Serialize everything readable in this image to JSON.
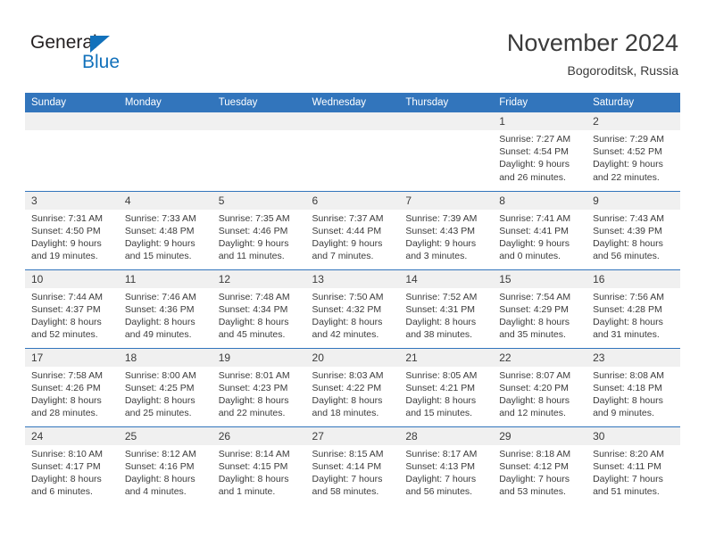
{
  "brand": {
    "name_part1": "General",
    "name_part2": "Blue",
    "triangle_color": "#1271bb"
  },
  "header": {
    "title": "November 2024",
    "location": "Bogoroditsk, Russia",
    "header_bg": "#3275bc",
    "daynum_bg": "#f0f0f0",
    "text_color": "#3b3b3b"
  },
  "weekday_headers": [
    "Sunday",
    "Monday",
    "Tuesday",
    "Wednesday",
    "Thursday",
    "Friday",
    "Saturday"
  ],
  "labels": {
    "sunrise_prefix": "Sunrise: ",
    "sunset_prefix": "Sunset: ",
    "daylight_prefix": "Daylight: "
  },
  "weeks": [
    [
      {
        "day": "",
        "empty": true
      },
      {
        "day": "",
        "empty": true
      },
      {
        "day": "",
        "empty": true
      },
      {
        "day": "",
        "empty": true
      },
      {
        "day": "",
        "empty": true
      },
      {
        "day": "1",
        "sunrise": "Sunrise: 7:27 AM",
        "sunset": "Sunset: 4:54 PM",
        "daylight": "Daylight: 9 hours and 26 minutes."
      },
      {
        "day": "2",
        "sunrise": "Sunrise: 7:29 AM",
        "sunset": "Sunset: 4:52 PM",
        "daylight": "Daylight: 9 hours and 22 minutes."
      }
    ],
    [
      {
        "day": "3",
        "sunrise": "Sunrise: 7:31 AM",
        "sunset": "Sunset: 4:50 PM",
        "daylight": "Daylight: 9 hours and 19 minutes."
      },
      {
        "day": "4",
        "sunrise": "Sunrise: 7:33 AM",
        "sunset": "Sunset: 4:48 PM",
        "daylight": "Daylight: 9 hours and 15 minutes."
      },
      {
        "day": "5",
        "sunrise": "Sunrise: 7:35 AM",
        "sunset": "Sunset: 4:46 PM",
        "daylight": "Daylight: 9 hours and 11 minutes."
      },
      {
        "day": "6",
        "sunrise": "Sunrise: 7:37 AM",
        "sunset": "Sunset: 4:44 PM",
        "daylight": "Daylight: 9 hours and 7 minutes."
      },
      {
        "day": "7",
        "sunrise": "Sunrise: 7:39 AM",
        "sunset": "Sunset: 4:43 PM",
        "daylight": "Daylight: 9 hours and 3 minutes."
      },
      {
        "day": "8",
        "sunrise": "Sunrise: 7:41 AM",
        "sunset": "Sunset: 4:41 PM",
        "daylight": "Daylight: 9 hours and 0 minutes."
      },
      {
        "day": "9",
        "sunrise": "Sunrise: 7:43 AM",
        "sunset": "Sunset: 4:39 PM",
        "daylight": "Daylight: 8 hours and 56 minutes."
      }
    ],
    [
      {
        "day": "10",
        "sunrise": "Sunrise: 7:44 AM",
        "sunset": "Sunset: 4:37 PM",
        "daylight": "Daylight: 8 hours and 52 minutes."
      },
      {
        "day": "11",
        "sunrise": "Sunrise: 7:46 AM",
        "sunset": "Sunset: 4:36 PM",
        "daylight": "Daylight: 8 hours and 49 minutes."
      },
      {
        "day": "12",
        "sunrise": "Sunrise: 7:48 AM",
        "sunset": "Sunset: 4:34 PM",
        "daylight": "Daylight: 8 hours and 45 minutes."
      },
      {
        "day": "13",
        "sunrise": "Sunrise: 7:50 AM",
        "sunset": "Sunset: 4:32 PM",
        "daylight": "Daylight: 8 hours and 42 minutes."
      },
      {
        "day": "14",
        "sunrise": "Sunrise: 7:52 AM",
        "sunset": "Sunset: 4:31 PM",
        "daylight": "Daylight: 8 hours and 38 minutes."
      },
      {
        "day": "15",
        "sunrise": "Sunrise: 7:54 AM",
        "sunset": "Sunset: 4:29 PM",
        "daylight": "Daylight: 8 hours and 35 minutes."
      },
      {
        "day": "16",
        "sunrise": "Sunrise: 7:56 AM",
        "sunset": "Sunset: 4:28 PM",
        "daylight": "Daylight: 8 hours and 31 minutes."
      }
    ],
    [
      {
        "day": "17",
        "sunrise": "Sunrise: 7:58 AM",
        "sunset": "Sunset: 4:26 PM",
        "daylight": "Daylight: 8 hours and 28 minutes."
      },
      {
        "day": "18",
        "sunrise": "Sunrise: 8:00 AM",
        "sunset": "Sunset: 4:25 PM",
        "daylight": "Daylight: 8 hours and 25 minutes."
      },
      {
        "day": "19",
        "sunrise": "Sunrise: 8:01 AM",
        "sunset": "Sunset: 4:23 PM",
        "daylight": "Daylight: 8 hours and 22 minutes."
      },
      {
        "day": "20",
        "sunrise": "Sunrise: 8:03 AM",
        "sunset": "Sunset: 4:22 PM",
        "daylight": "Daylight: 8 hours and 18 minutes."
      },
      {
        "day": "21",
        "sunrise": "Sunrise: 8:05 AM",
        "sunset": "Sunset: 4:21 PM",
        "daylight": "Daylight: 8 hours and 15 minutes."
      },
      {
        "day": "22",
        "sunrise": "Sunrise: 8:07 AM",
        "sunset": "Sunset: 4:20 PM",
        "daylight": "Daylight: 8 hours and 12 minutes."
      },
      {
        "day": "23",
        "sunrise": "Sunrise: 8:08 AM",
        "sunset": "Sunset: 4:18 PM",
        "daylight": "Daylight: 8 hours and 9 minutes."
      }
    ],
    [
      {
        "day": "24",
        "sunrise": "Sunrise: 8:10 AM",
        "sunset": "Sunset: 4:17 PM",
        "daylight": "Daylight: 8 hours and 6 minutes."
      },
      {
        "day": "25",
        "sunrise": "Sunrise: 8:12 AM",
        "sunset": "Sunset: 4:16 PM",
        "daylight": "Daylight: 8 hours and 4 minutes."
      },
      {
        "day": "26",
        "sunrise": "Sunrise: 8:14 AM",
        "sunset": "Sunset: 4:15 PM",
        "daylight": "Daylight: 8 hours and 1 minute."
      },
      {
        "day": "27",
        "sunrise": "Sunrise: 8:15 AM",
        "sunset": "Sunset: 4:14 PM",
        "daylight": "Daylight: 7 hours and 58 minutes."
      },
      {
        "day": "28",
        "sunrise": "Sunrise: 8:17 AM",
        "sunset": "Sunset: 4:13 PM",
        "daylight": "Daylight: 7 hours and 56 minutes."
      },
      {
        "day": "29",
        "sunrise": "Sunrise: 8:18 AM",
        "sunset": "Sunset: 4:12 PM",
        "daylight": "Daylight: 7 hours and 53 minutes."
      },
      {
        "day": "30",
        "sunrise": "Sunrise: 8:20 AM",
        "sunset": "Sunset: 4:11 PM",
        "daylight": "Daylight: 7 hours and 51 minutes."
      }
    ]
  ]
}
